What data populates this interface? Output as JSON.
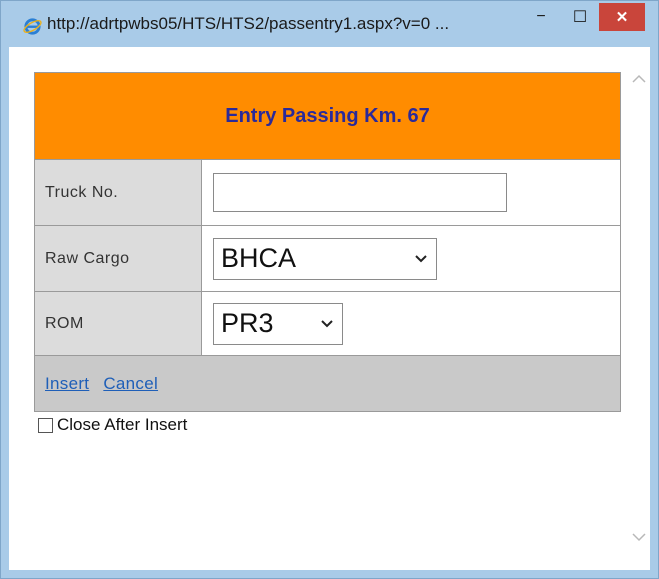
{
  "window": {
    "title": "http://adrtpwbs05/HTS/HTS2/passentry1.aspx?v=0 ...",
    "minimize_symbol": "−",
    "maximize_symbol": "☐",
    "close_symbol": "✕",
    "icon": "ie-icon"
  },
  "form": {
    "header_title": "Entry Passing Km. 67",
    "header_color": "#ff8c00",
    "fields": {
      "truck": {
        "label": "Truck No.",
        "value": ""
      },
      "raw_cargo": {
        "label": "Raw Cargo",
        "selected": "BHCA"
      },
      "rom": {
        "label": "ROM",
        "selected": "PR3"
      }
    },
    "actions": {
      "insert": "Insert",
      "cancel": "Cancel"
    },
    "close_after_insert": {
      "label": "Close After Insert",
      "checked": false
    }
  }
}
